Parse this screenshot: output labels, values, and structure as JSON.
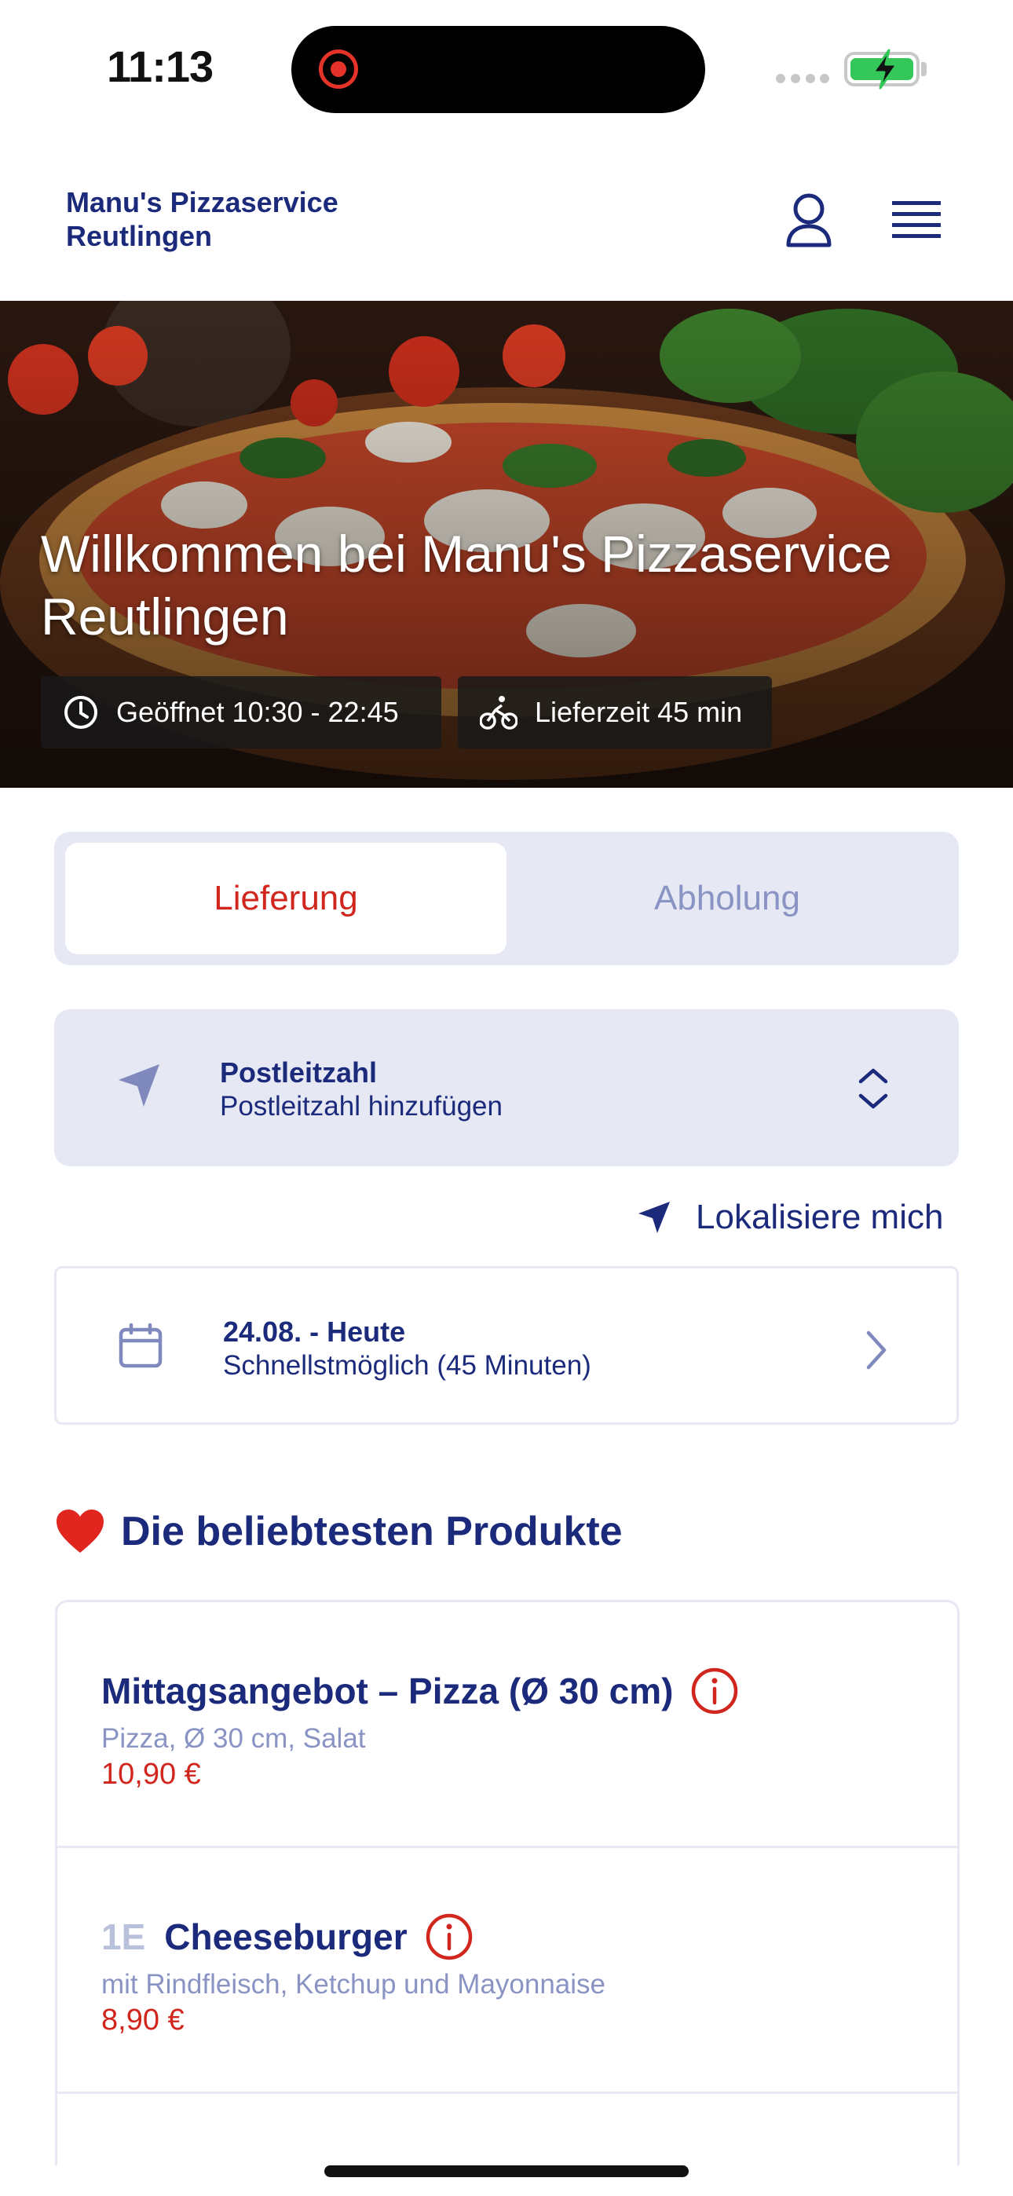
{
  "status_bar": {
    "time": "11:13"
  },
  "header": {
    "brand_line1": "Manu's Pizzaservice",
    "brand_line2": "Reutlingen"
  },
  "hero": {
    "title": "Willkommen bei Manu's Pizzaservice Reutlingen",
    "opening_hours": "Geöffnet 10:30 - 22:45",
    "delivery_time": "Lieferzeit 45 min"
  },
  "order_mode": {
    "options": [
      "Lieferung",
      "Abholung"
    ],
    "selected": "Lieferung"
  },
  "postal_code": {
    "label": "Postleitzahl",
    "placeholder": "Postleitzahl hinzufügen"
  },
  "locate_me": "Lokalisiere mich",
  "schedule": {
    "date": "24.08. - Heute",
    "time": "Schnellstmöglich (45 Minuten)"
  },
  "popular": {
    "title": "Die beliebtesten Produkte",
    "products": [
      {
        "number": "",
        "name": "Mittagsangebot – Pizza (Ø 30 cm)",
        "description": "Pizza, Ø 30 cm, Salat",
        "price": "10,90 €"
      },
      {
        "number": "1E",
        "name": "Cheeseburger",
        "description": "mit Rindfleisch, Ketchup und Mayonnaise",
        "price": "8,90 €"
      }
    ]
  },
  "colors": {
    "brand_blue": "#1b2a7b",
    "accent_red": "#d0261d",
    "panel_bg": "#e6e8f3",
    "muted_text": "#8a94c4"
  },
  "icons": [
    "user-icon",
    "hamburger-menu-icon",
    "clock-icon",
    "bicycle-icon",
    "location-arrow-icon",
    "up-down-chevron-icon",
    "calendar-icon",
    "chevron-right-icon",
    "heart-icon",
    "info-icon"
  ]
}
